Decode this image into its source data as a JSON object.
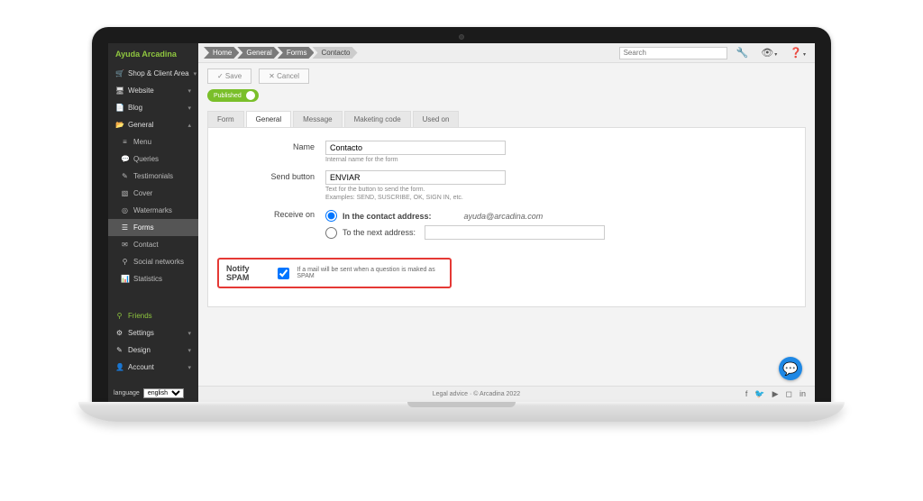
{
  "brand": "Ayuda Arcadina",
  "sidebar": {
    "primary": [
      {
        "icon": "🛒",
        "label": "Shop & Client Area",
        "chev": "▾"
      },
      {
        "icon": "🖥",
        "label": "Website",
        "chev": "▾"
      },
      {
        "icon": "📄",
        "label": "Blog",
        "chev": "▾"
      },
      {
        "icon": "📂",
        "label": "General",
        "chev": "▴"
      }
    ],
    "sub": [
      {
        "icon": "≡",
        "label": "Menu"
      },
      {
        "icon": "💬",
        "label": "Queries"
      },
      {
        "icon": "✎",
        "label": "Testimonials"
      },
      {
        "icon": "▧",
        "label": "Cover"
      },
      {
        "icon": "◎",
        "label": "Watermarks"
      },
      {
        "icon": "☰",
        "label": "Forms"
      },
      {
        "icon": "✉",
        "label": "Contact"
      },
      {
        "icon": "⚲",
        "label": "Social networks"
      },
      {
        "icon": "📊",
        "label": "Statistics"
      }
    ],
    "bottom": [
      {
        "icon": "⚲",
        "label": "Friends",
        "green": true
      },
      {
        "icon": "⚙",
        "label": "Settings",
        "chev": "▾"
      },
      {
        "icon": "✎",
        "label": "Design",
        "chev": "▾"
      },
      {
        "icon": "👤",
        "label": "Account",
        "chev": "▾"
      }
    ],
    "lang_label": "language",
    "lang_value": "english"
  },
  "topbar": {
    "crumbs": [
      "Home",
      "General",
      "Forms",
      "Contacto"
    ],
    "search_placeholder": "Search"
  },
  "actions": {
    "save": "✓ Save",
    "cancel": "✕ Cancel"
  },
  "published": {
    "label": "Published"
  },
  "tabs": [
    "Form",
    "General",
    "Message",
    "Maketing code",
    "Used on"
  ],
  "active_tab": "General",
  "form": {
    "name_label": "Name",
    "name_value": "Contacto",
    "name_hint": "Internal name for the form",
    "send_label": "Send button",
    "send_value": "ENVIAR",
    "send_hint1": "Text for the button to send the form.",
    "send_hint2": "Examples: SEND, SUSCRIBE, OK, SIGN IN, etc.",
    "receive_label": "Receive on",
    "receive_opt1": "In the contact address:",
    "receive_addr": "ayuda@arcadina.com",
    "receive_opt2": "To the next address:",
    "notify_label": "Notify SPAM",
    "notify_desc": "If a mail will be sent when a question is maked as SPAM"
  },
  "footer": {
    "center": "Legal advice ·  © Arcadina 2022"
  }
}
